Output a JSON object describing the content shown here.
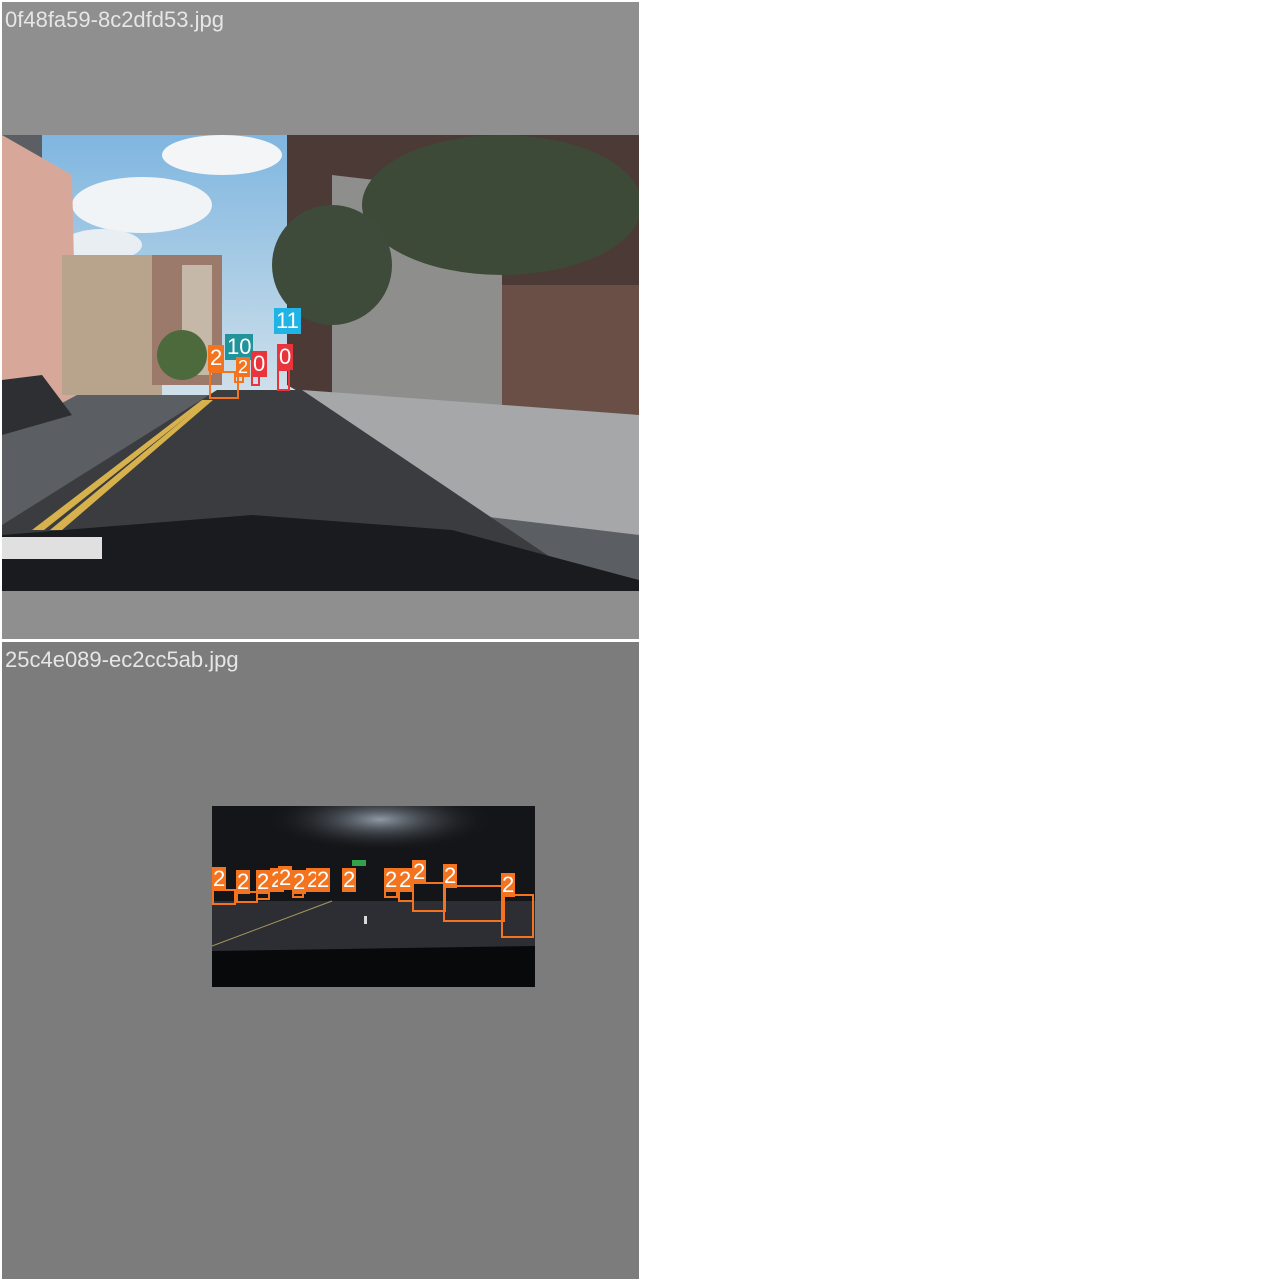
{
  "mosaic": {
    "tiles": [
      {
        "filename": "0f48fa59-8c2dfd53.jpg"
      },
      {
        "filename": "25c4e089-ec2cc5ab.jpg"
      }
    ]
  },
  "detections": {
    "tile1": [
      {
        "class_label": "2",
        "color": "#f3731f"
      },
      {
        "class_label": "10",
        "color": "#21939a"
      },
      {
        "class_label": "2",
        "color": "#f3731f"
      },
      {
        "class_label": "0",
        "color": "#e8353b"
      },
      {
        "class_label": "0",
        "color": "#e8353b"
      },
      {
        "class_label": "11",
        "color": "#1fb3e6"
      }
    ],
    "tile2": [
      {
        "class_label": "2",
        "color": "#f3731f"
      },
      {
        "class_label": "2",
        "color": "#f3731f"
      },
      {
        "class_label": "2",
        "color": "#f3731f"
      },
      {
        "class_label": "2",
        "color": "#f3731f"
      },
      {
        "class_label": "2",
        "color": "#f3731f"
      },
      {
        "class_label": "2",
        "color": "#f3731f"
      },
      {
        "class_label": "2",
        "color": "#f3731f"
      },
      {
        "class_label": "2",
        "color": "#f3731f"
      },
      {
        "class_label": "2",
        "color": "#f3731f"
      },
      {
        "class_label": "2",
        "color": "#f3731f"
      },
      {
        "class_label": "2",
        "color": "#f3731f"
      },
      {
        "class_label": "2",
        "color": "#f3731f"
      },
      {
        "class_label": "2",
        "color": "#f3731f"
      },
      {
        "class_label": "2",
        "color": "#f3731f"
      }
    ]
  }
}
